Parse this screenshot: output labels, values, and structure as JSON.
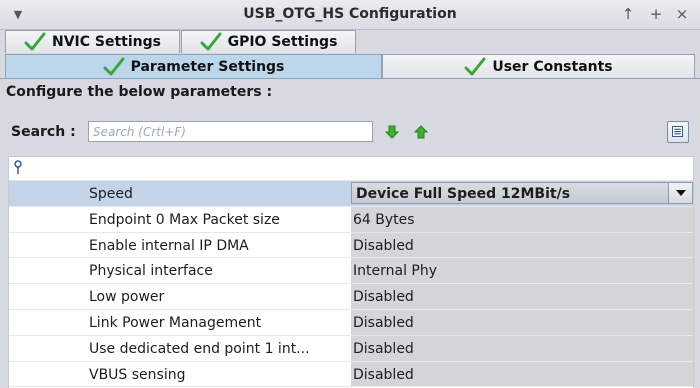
{
  "window": {
    "title": "USB_OTG_HS Configuration",
    "pin_label": "↑",
    "maximize_label": "+",
    "close_label": "×"
  },
  "tabs": {
    "nvic": "NVIC Settings",
    "gpio": "GPIO Settings",
    "parameters": "Parameter Settings",
    "user_constants": "User Constants"
  },
  "content": {
    "instruction": "Configure the below parameters :",
    "search_label": "Search :",
    "search_placeholder": "Search (Crtl+F)"
  },
  "parameters": [
    {
      "name": "Speed",
      "value": "Device Full Speed 12MBit/s"
    },
    {
      "name": "Endpoint 0 Max Packet size",
      "value": "64 Bytes"
    },
    {
      "name": "Enable internal IP DMA",
      "value": "Disabled"
    },
    {
      "name": "Physical interface",
      "value": "Internal Phy"
    },
    {
      "name": "Low power",
      "value": "Disabled"
    },
    {
      "name": "Link Power Management",
      "value": "Disabled"
    },
    {
      "name": "Use dedicated end point 1 int...",
      "value": "Disabled"
    },
    {
      "name": "VBUS sensing",
      "value": "Disabled"
    }
  ],
  "colors": {
    "check_green": "#3aa53a",
    "active_tab": "#bcd6ec",
    "selected_row": "#c3d4e9"
  }
}
